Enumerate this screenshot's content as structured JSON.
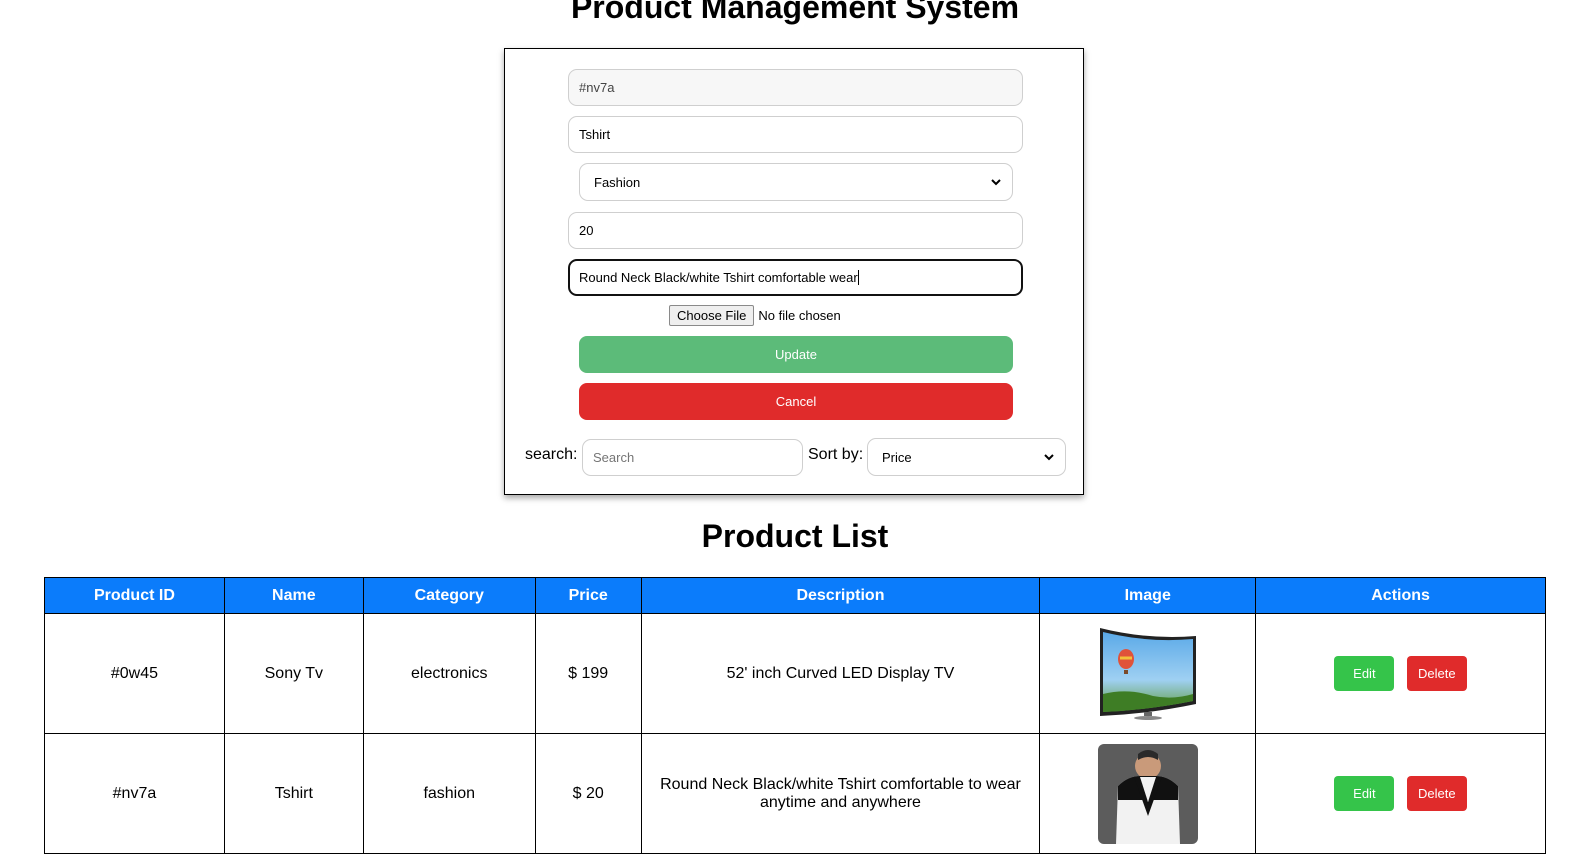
{
  "page_title": "Product Management System",
  "form": {
    "id_value": "#nv7a",
    "name_value": "Tshirt",
    "category_selected": "Fashion",
    "price_value": "20",
    "description_value": "Round Neck Black/white Tshirt comfortable wear",
    "file_button_label": "Choose File",
    "file_status": "No file chosen",
    "update_label": "Update",
    "cancel_label": "Cancel",
    "search_label": "search:",
    "search_placeholder": "Search",
    "sort_label": "Sort by:",
    "sort_selected": "Price"
  },
  "list_title": "Product List",
  "table": {
    "headers": [
      "Product ID",
      "Name",
      "Category",
      "Price",
      "Description",
      "Image",
      "Actions"
    ],
    "rows": [
      {
        "id": "#0w45",
        "name": "Sony Tv",
        "category": "electronics",
        "price": "$ 199",
        "description": "52' inch Curved LED Display TV",
        "image_icon": "curved-tv-image",
        "edit_label": "Edit",
        "delete_label": "Delete"
      },
      {
        "id": "#nv7a",
        "name": "Tshirt",
        "category": "fashion",
        "price": "$ 20",
        "description": "Round Neck Black/white Tshirt comfortable to wear anytime and anywhere",
        "image_icon": "tshirt-image",
        "edit_label": "Edit",
        "delete_label": "Delete"
      }
    ]
  },
  "colors": {
    "header_bg": "#0b7cfb",
    "update_green": "#5cbb79",
    "cancel_red": "#e02b2b",
    "edit_green": "#35c44a",
    "delete_red": "#e02b2b"
  }
}
